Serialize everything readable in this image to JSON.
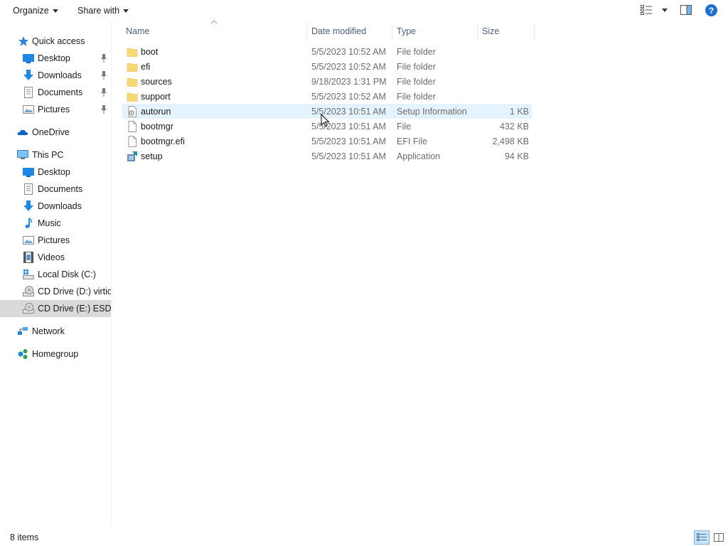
{
  "toolbar": {
    "organize_label": "Organize",
    "share_label": "Share with",
    "view_icon": "details-view-icon",
    "pane_icon": "preview-pane-icon",
    "help_label": "?"
  },
  "nav": {
    "quick_access": {
      "label": "Quick access",
      "items": [
        {
          "label": "Desktop",
          "icon": "desktop-icon",
          "pinned": true
        },
        {
          "label": "Downloads",
          "icon": "downloads-icon",
          "pinned": true
        },
        {
          "label": "Documents",
          "icon": "documents-icon",
          "pinned": true
        },
        {
          "label": "Pictures",
          "icon": "pictures-icon",
          "pinned": true
        }
      ]
    },
    "onedrive": {
      "label": "OneDrive"
    },
    "this_pc": {
      "label": "This PC",
      "items": [
        {
          "label": "Desktop",
          "icon": "desktop-icon"
        },
        {
          "label": "Documents",
          "icon": "documents-icon"
        },
        {
          "label": "Downloads",
          "icon": "downloads-icon"
        },
        {
          "label": "Music",
          "icon": "music-icon"
        },
        {
          "label": "Pictures",
          "icon": "pictures-icon"
        },
        {
          "label": "Videos",
          "icon": "videos-icon"
        },
        {
          "label": "Local Disk (C:)",
          "icon": "local-disk-icon"
        },
        {
          "label": "CD Drive (D:) virtio-",
          "icon": "cd-drive-icon"
        },
        {
          "label": "CD Drive (E:) ESD-IS",
          "icon": "cd-drive-icon",
          "selected": true
        }
      ]
    },
    "network": {
      "label": "Network"
    },
    "homegroup": {
      "label": "Homegroup"
    }
  },
  "columns": {
    "name": "Name",
    "date": "Date modified",
    "type": "Type",
    "size": "Size"
  },
  "files": [
    {
      "name": "boot",
      "date": "5/5/2023 10:52 AM",
      "type": "File folder",
      "size": "",
      "icon": "folder-icon"
    },
    {
      "name": "efi",
      "date": "5/5/2023 10:52 AM",
      "type": "File folder",
      "size": "",
      "icon": "folder-icon"
    },
    {
      "name": "sources",
      "date": "9/18/2023 1:31 PM",
      "type": "File folder",
      "size": "",
      "icon": "folder-icon"
    },
    {
      "name": "support",
      "date": "5/5/2023 10:52 AM",
      "type": "File folder",
      "size": "",
      "icon": "folder-icon"
    },
    {
      "name": "autorun",
      "date": "5/5/2023 10:51 AM",
      "type": "Setup Information",
      "size": "1 KB",
      "icon": "setup-info-icon",
      "hover": true
    },
    {
      "name": "bootmgr",
      "date": "5/5/2023 10:51 AM",
      "type": "File",
      "size": "432 KB",
      "icon": "file-icon"
    },
    {
      "name": "bootmgr.efi",
      "date": "5/5/2023 10:51 AM",
      "type": "EFI File",
      "size": "2,498 KB",
      "icon": "file-icon"
    },
    {
      "name": "setup",
      "date": "5/5/2023 10:51 AM",
      "type": "Application",
      "size": "94 KB",
      "icon": "setup-app-icon"
    }
  ],
  "status": {
    "item_count": "8 items"
  },
  "colors": {
    "accent": "#1e6fcf",
    "folder": "#f8d775",
    "selection": "#d9d9d9",
    "hover": "#e5f3ff",
    "header_text": "#4c607a"
  }
}
